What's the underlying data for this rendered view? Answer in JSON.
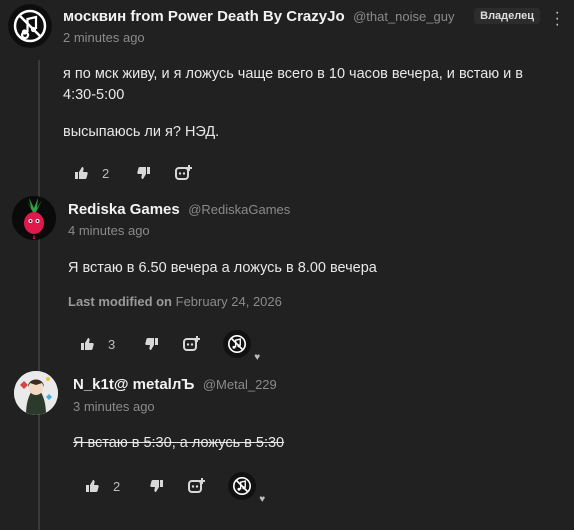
{
  "comments": [
    {
      "author": "москвин from Power Death By CrazyJo",
      "handle": "@that_noise_guy",
      "time": "2 minutes ago",
      "badge": "Владелец",
      "body_lines": [
        "я по мск живу, и я ложусь чаще всего в 10 часов вечера, и встаю и в 4:30-5:00",
        "высыпаюсь ли я? НЭД."
      ],
      "likes": "2"
    },
    {
      "author": "Rediska Games",
      "handle": "@RediskaGames",
      "time": "4 minutes ago",
      "body": "Я встаю в 6.50 вечера а ложусь в 8.00 вечера",
      "modified_label": "Last modified on",
      "modified_date": "February 24, 2026",
      "likes": "3"
    },
    {
      "author": "N_k1t@ metalлЪ",
      "handle": "@Metal_229",
      "time": "3 minutes ago",
      "body": "Я встаю в 5:30, а ложусь в 5:30",
      "likes": "2"
    }
  ],
  "icons": {
    "like": "thumbs-up-icon",
    "dislike": "thumbs-down-icon",
    "reply": "reply-icon",
    "more": "kebab-menu-icon",
    "creator_heart": "heart-icon"
  }
}
